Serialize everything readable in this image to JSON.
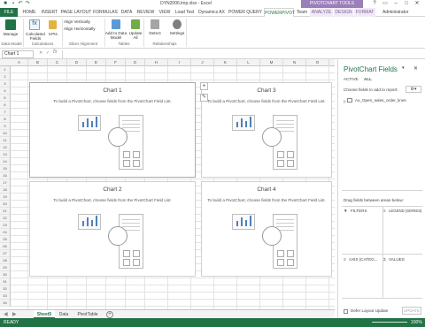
{
  "app": {
    "window_title": "DYN2006.lmp.xlsx - Excel",
    "context_tools": "PIVOTCHART TOOLS",
    "user": "Administrator"
  },
  "tabs": [
    "FILE",
    "HOME",
    "INSERT",
    "PAGE LAYOUT",
    "FORMULAS",
    "DATA",
    "REVIEW",
    "VIEW",
    "Load Test",
    "Dynamics AX",
    "POWER QUERY",
    "POWERPIVOT",
    "Team",
    "ANALYZE",
    "DESIGN",
    "FORMAT"
  ],
  "ribbon": {
    "manage": "Manage",
    "calculated_fields": "Calculated Fields",
    "kpis": "KPIs",
    "align_vertically": "Align Vertically",
    "align_horizontally": "Align Horizontally",
    "add_to_data_model": "Add to Data Model",
    "update_all": "Update All",
    "detect": "Detect",
    "settings": "Settings",
    "groups": [
      "Data Model",
      "Calculations",
      "Slicer Alignment",
      "Tables",
      "Relationships"
    ]
  },
  "formula_bar": {
    "name_box": "Chart 1",
    "value": ""
  },
  "columns": [
    "A",
    "B",
    "C",
    "D",
    "E",
    "F",
    "G",
    "H",
    "I",
    "J",
    "K",
    "L",
    "M",
    "N",
    "O"
  ],
  "charts": [
    {
      "title": "Chart 1",
      "instruction": "To build a PivotChart, choose fields from the PivotChart Field List."
    },
    {
      "title": "Chart 3",
      "instruction": "To build a PivotChart, choose fields from the PivotChart Field List."
    },
    {
      "title": "Chart 2",
      "instruction": "To build a PivotChart, choose fields from the PivotChart Field List."
    },
    {
      "title": "Chart 4",
      "instruction": "To build a PivotChart, choose fields from the PivotChart Field List."
    }
  ],
  "sheets": [
    "Sheet5",
    "Data",
    "PivotTable"
  ],
  "status": {
    "left": "READY",
    "zoom": "100%"
  },
  "pane": {
    "title": "PivotChart Fields",
    "tab_active": "ACTIVE",
    "tab_all": "ALL",
    "choose": "Choose fields to add to report:",
    "field": "Ax_Open_sales_order_lines",
    "drag": "Drag fields between areas below:",
    "filters": "FILTERS",
    "legend": "LEGEND (SERIES)",
    "axis": "AXIS (CATEG...",
    "values": "VALUES",
    "defer": "Defer Layout Update",
    "update": "UPDATE"
  }
}
